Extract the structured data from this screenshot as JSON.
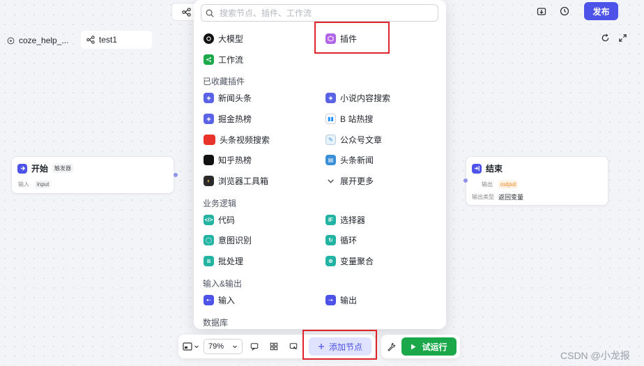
{
  "header": {
    "publish_label": "发布"
  },
  "breadcrumb": {
    "bot_name": "coze_help_...",
    "workflow_name": "test1"
  },
  "start_node": {
    "title": "开始",
    "badge": "触发器",
    "field_label": "输入",
    "field_value": "input"
  },
  "end_node": {
    "title": "结束",
    "field1_label": "输出",
    "field1_value": "output",
    "field2_label": "输出类型",
    "field2_value": "返回变量"
  },
  "popup": {
    "search_placeholder": "搜索节点、插件、工作流",
    "top_items": [
      {
        "label": "大模型",
        "icon": "llm-icon"
      },
      {
        "label": "插件",
        "icon": "plugin-icon"
      },
      {
        "label": "工作流",
        "icon": "workflow-icon"
      }
    ],
    "favorites_title": "已收藏插件",
    "favorites": [
      {
        "label": "新闻头条",
        "icon": "plugin-icon"
      },
      {
        "label": "小说内容搜索",
        "icon": "plugin-icon"
      },
      {
        "label": "掘金热榜",
        "icon": "plugin-icon"
      },
      {
        "label": "B 站热搜",
        "icon": "bilibili-icon"
      },
      {
        "label": "头条视频搜索",
        "icon": "toutiao-icon"
      },
      {
        "label": "公众号文章",
        "icon": "wechat-article-icon"
      },
      {
        "label": "知乎热榜",
        "icon": "zhihu-icon"
      },
      {
        "label": "头条新闻",
        "icon": "news-icon"
      },
      {
        "label": "浏览器工具箱",
        "icon": "browser-icon"
      },
      {
        "label": "展开更多",
        "icon": "chevron-down-icon"
      }
    ],
    "logic_title": "业务逻辑",
    "logic": [
      {
        "label": "代码",
        "icon": "code-icon"
      },
      {
        "label": "选择器",
        "icon": "if-icon"
      },
      {
        "label": "意图识别",
        "icon": "intent-icon"
      },
      {
        "label": "循环",
        "icon": "loop-icon"
      },
      {
        "label": "批处理",
        "icon": "batch-icon"
      },
      {
        "label": "变量聚合",
        "icon": "aggregate-icon"
      }
    ],
    "io_title": "输入&输出",
    "io": [
      {
        "label": "输入",
        "icon": "input-icon"
      },
      {
        "label": "输出",
        "icon": "output-icon"
      }
    ],
    "db_title": "数据库"
  },
  "toolbar": {
    "zoom": "79%",
    "add_node_label": "添加节点",
    "run_label": "试运行"
  },
  "watermark": "CSDN @小龙报",
  "colors": {
    "accent": "#4d53e8",
    "run_green": "#1aa84a",
    "highlight_red": "#e0242b"
  }
}
